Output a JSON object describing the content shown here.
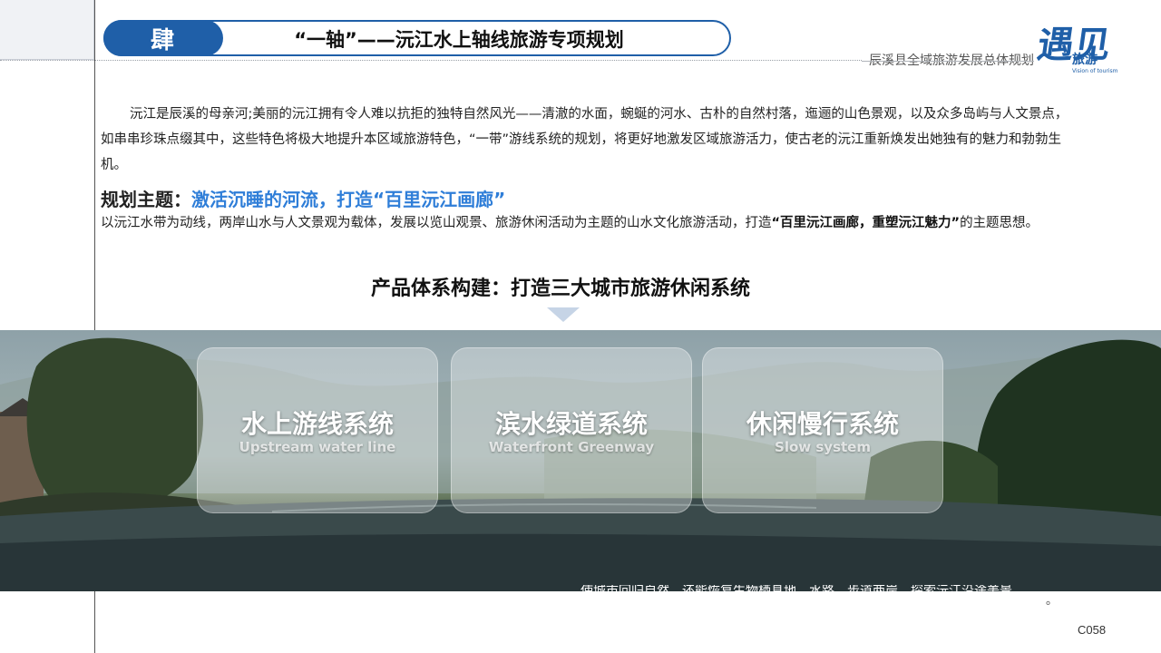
{
  "banner": {
    "section_label": "肆",
    "title": "“一轴”——沅江水上轴线旅游专项规划"
  },
  "header_right": {
    "subtitle": "辰溪县全域旅游发展总体规划",
    "logo_text": "旅游",
    "logo_sub": "Vision of tourism",
    "logo_brush": "遇见"
  },
  "intro": {
    "paragraph": "沅江是辰溪的母亲河;美丽的沅江拥有令人难以抗拒的独特自然风光——清澈的水面，蜿蜒的河水、古朴的自然村落，迤逦的山色景观，以及众多岛屿与人文景点，如串串珍珠点缀其中，这些特色将极大地提升本区域旅游特色，“一带”游线系统的规划，将更好地激发区域旅游活力，使古老的沅江重新焕发出她独有的魅力和勃勃生机。"
  },
  "theme": {
    "label": "规划主题：",
    "highlight": "激活沉睡的河流，打造“百里沅江画廊”"
  },
  "theme_desc": {
    "text": "以沅江水带为动线，两岸山水与人文景观为载体，发展以览山观景、旅游休闲活动为主题的山水文化旅游活动，打造",
    "bold": "“百里沅江画廊，重塑沅江魅力”",
    "tail": "的主题思想。"
  },
  "product": {
    "heading": "产品体系构建：打造三大城市旅游休闲系统"
  },
  "cards": [
    {
      "cn": "水上游线系统",
      "en": "Upstream water line"
    },
    {
      "cn": "滨水绿道系统",
      "en": "Waterfront Greenway"
    },
    {
      "cn": "休闲慢行系统",
      "en": "Slow system"
    }
  ],
  "overflow_text": "使城市回归自然，还能恢复生物栖息地，水路、步道两岸，探索沅江沿途美景",
  "period": "。",
  "page_number": "C058",
  "colors": {
    "brand_blue": "#1f5fa8",
    "highlight_blue": "#2f7ed8"
  }
}
